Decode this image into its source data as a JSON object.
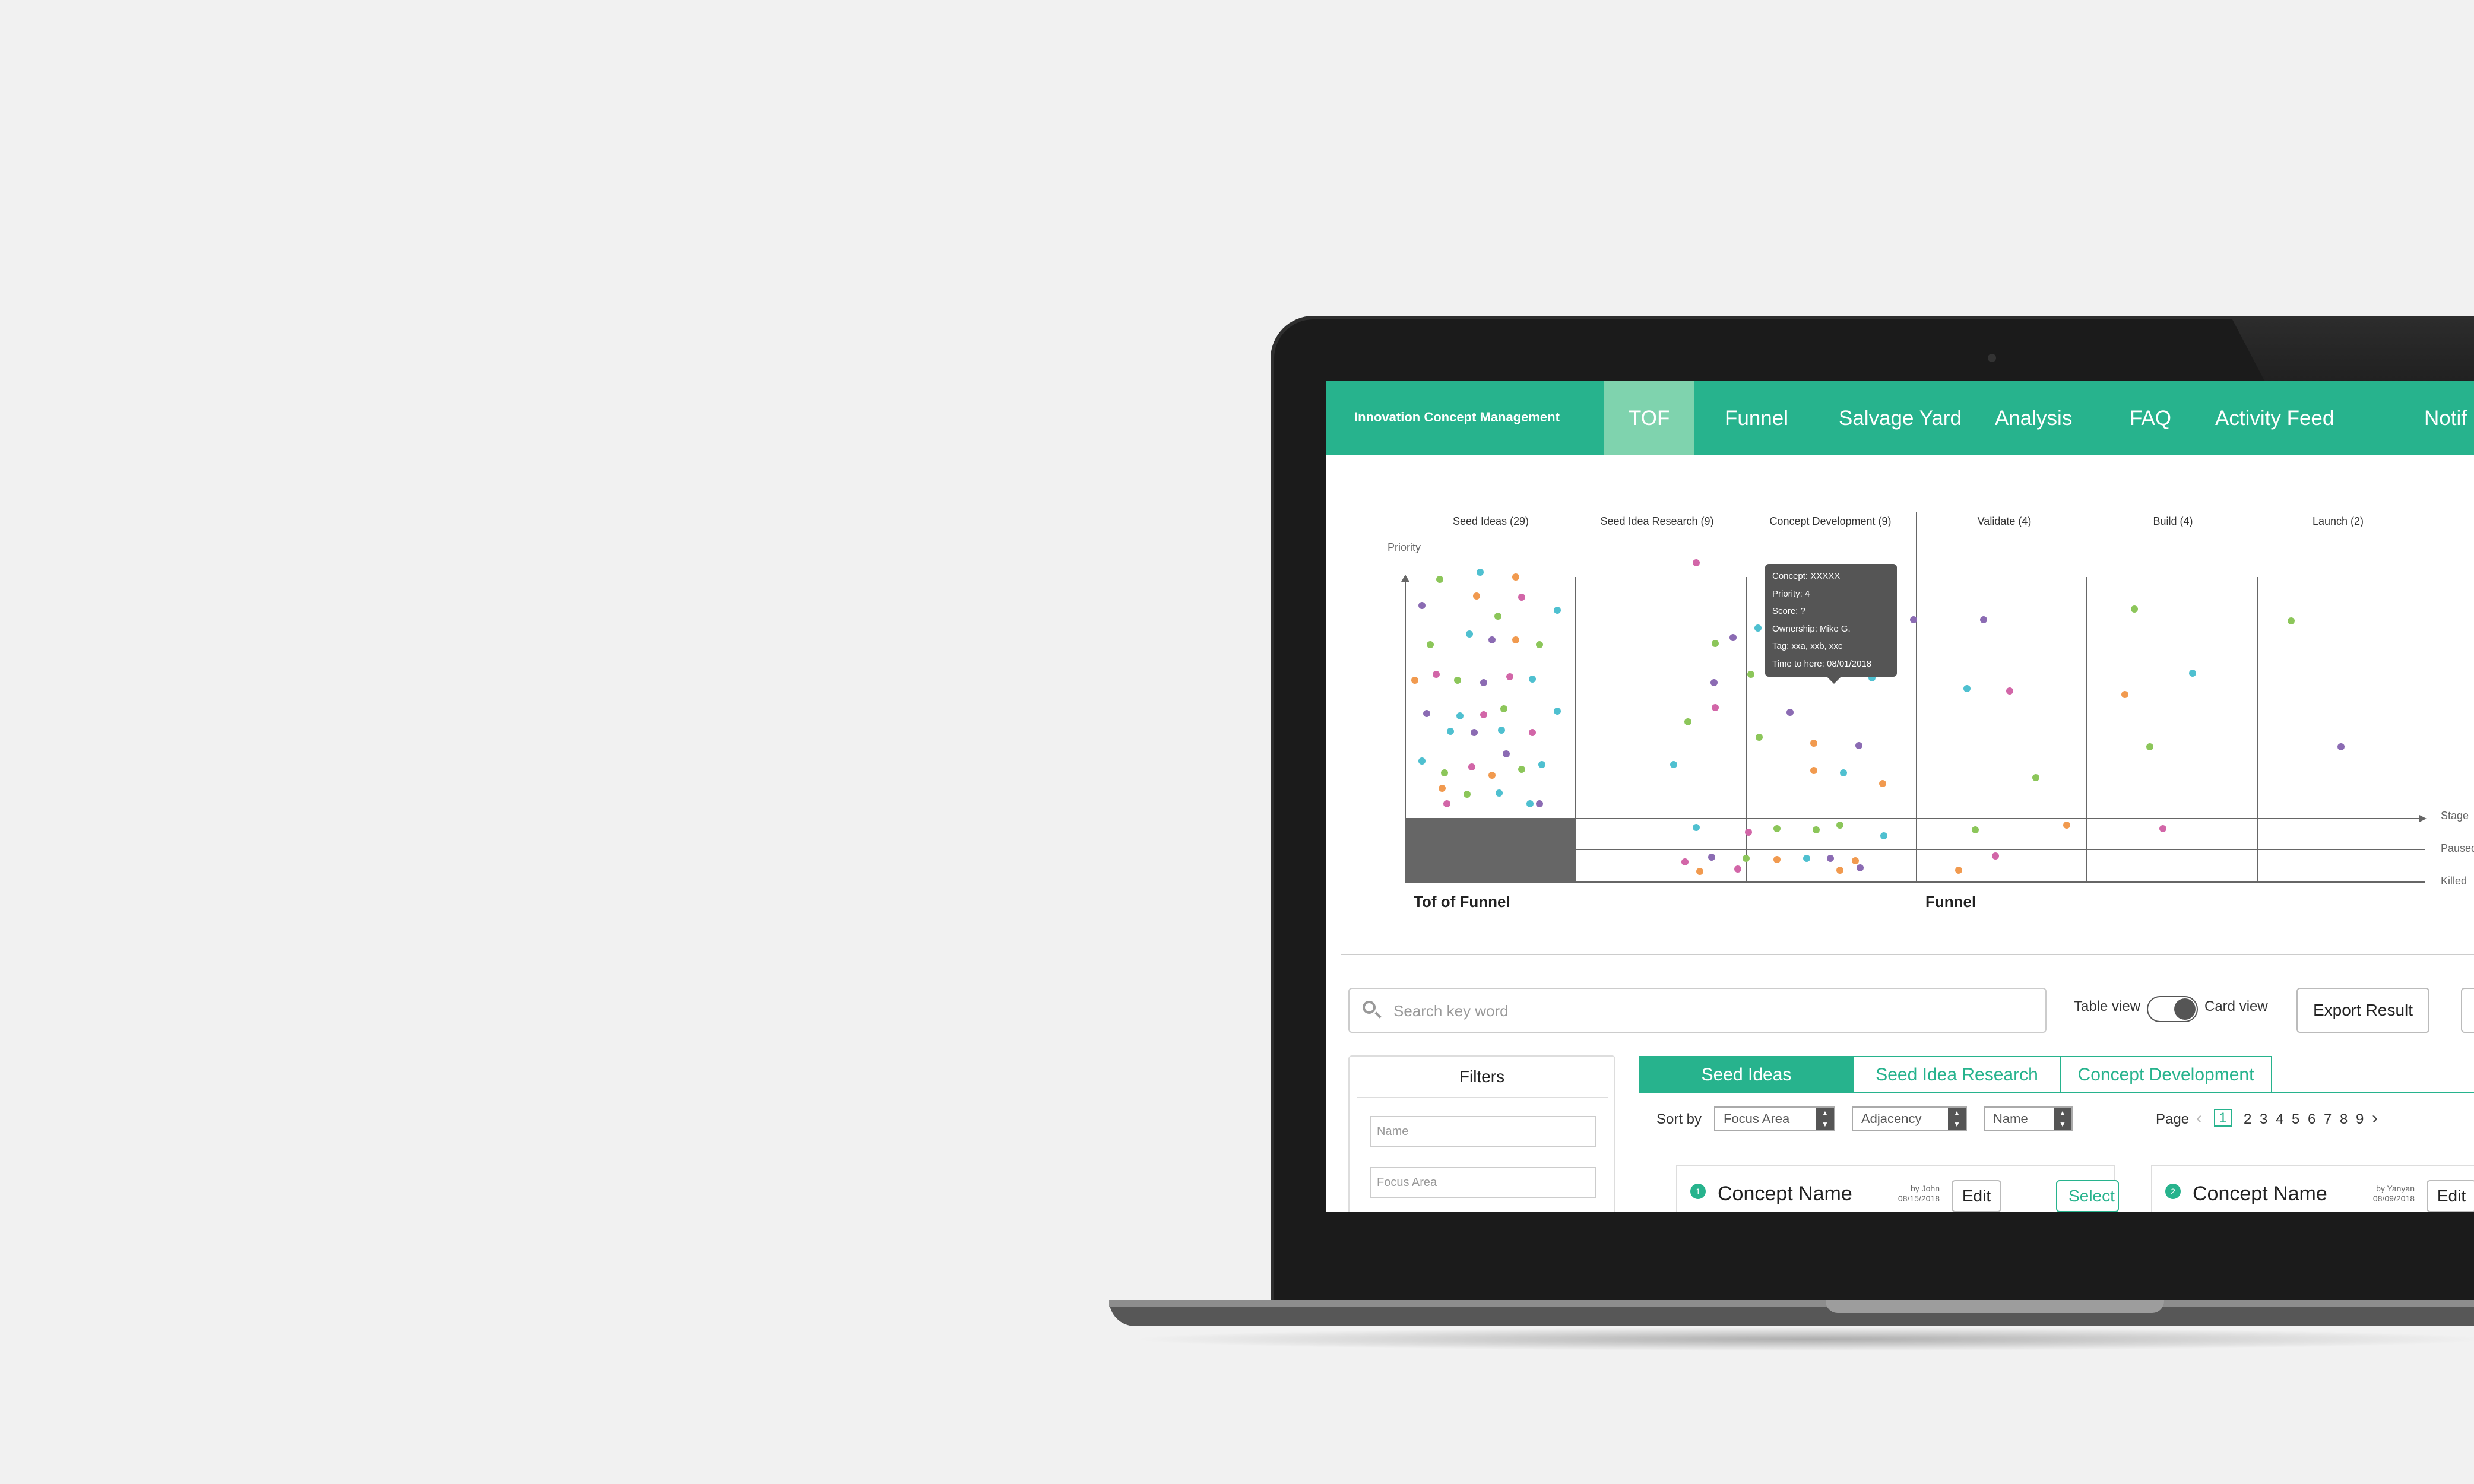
{
  "colors": {
    "brand": "#27b38d",
    "nav_active": "#7fd3ae",
    "dot_green": "#8cc65a",
    "dot_teal": "#4fc0d0",
    "dot_purple": "#8b6bb3",
    "dot_orange": "#f19a4f",
    "dot_pink": "#d266a8"
  },
  "header": {
    "app_title": "Innovation Concept Management",
    "nav": [
      {
        "label": "TOF",
        "active": true
      },
      {
        "label": "Funnel"
      },
      {
        "label": "Salvage Yard"
      },
      {
        "label": "Analysis"
      },
      {
        "label": "FAQ"
      },
      {
        "label": "Activity Feed"
      },
      {
        "label": "Notif"
      }
    ]
  },
  "chart": {
    "y_axis_label": "Priority",
    "stages": [
      "Seed Ideas (29)",
      "Seed Idea Research (9)",
      "Concept Development (9)",
      "Validate (4)",
      "Build (4)",
      "Launch (2)"
    ],
    "row_labels": {
      "stage": "Stage",
      "paused": "Paused",
      "killed": "Killed"
    },
    "sections": {
      "tof": "Tof of Funnel",
      "funnel": "Funnel"
    },
    "tooltip": [
      "Concept: XXXXX",
      "Priority: 4",
      "Score: ?",
      "Ownership: Mike G.",
      "Tag: xxa, xxb, xxc",
      "Time to here: 08/01/2018"
    ]
  },
  "toolbar": {
    "search_placeholder": "Search key word",
    "table_view": "Table view",
    "card_view": "Card view",
    "export": "Export Result"
  },
  "filters": {
    "title": "Filters",
    "name_placeholder": "Name",
    "focus_area_placeholder": "Focus Area"
  },
  "tabs": [
    "Seed Ideas",
    "Seed Idea Research",
    "Concept Development"
  ],
  "sort": {
    "label": "Sort by",
    "options": [
      "Focus Area",
      "Adjacency",
      "Name"
    ]
  },
  "pagination": {
    "label": "Page",
    "current": "1",
    "pages": [
      "2",
      "3",
      "4",
      "5",
      "6",
      "7",
      "8",
      "9"
    ]
  },
  "cards": [
    {
      "num": "1",
      "title": "Concept Name",
      "by": "by John",
      "date": "08/15/2018",
      "edit": "Edit",
      "select": "Select"
    },
    {
      "num": "2",
      "title": "Concept Name",
      "by": "by Yanyan",
      "date": "08/09/2018",
      "edit": "Edit"
    }
  ]
}
